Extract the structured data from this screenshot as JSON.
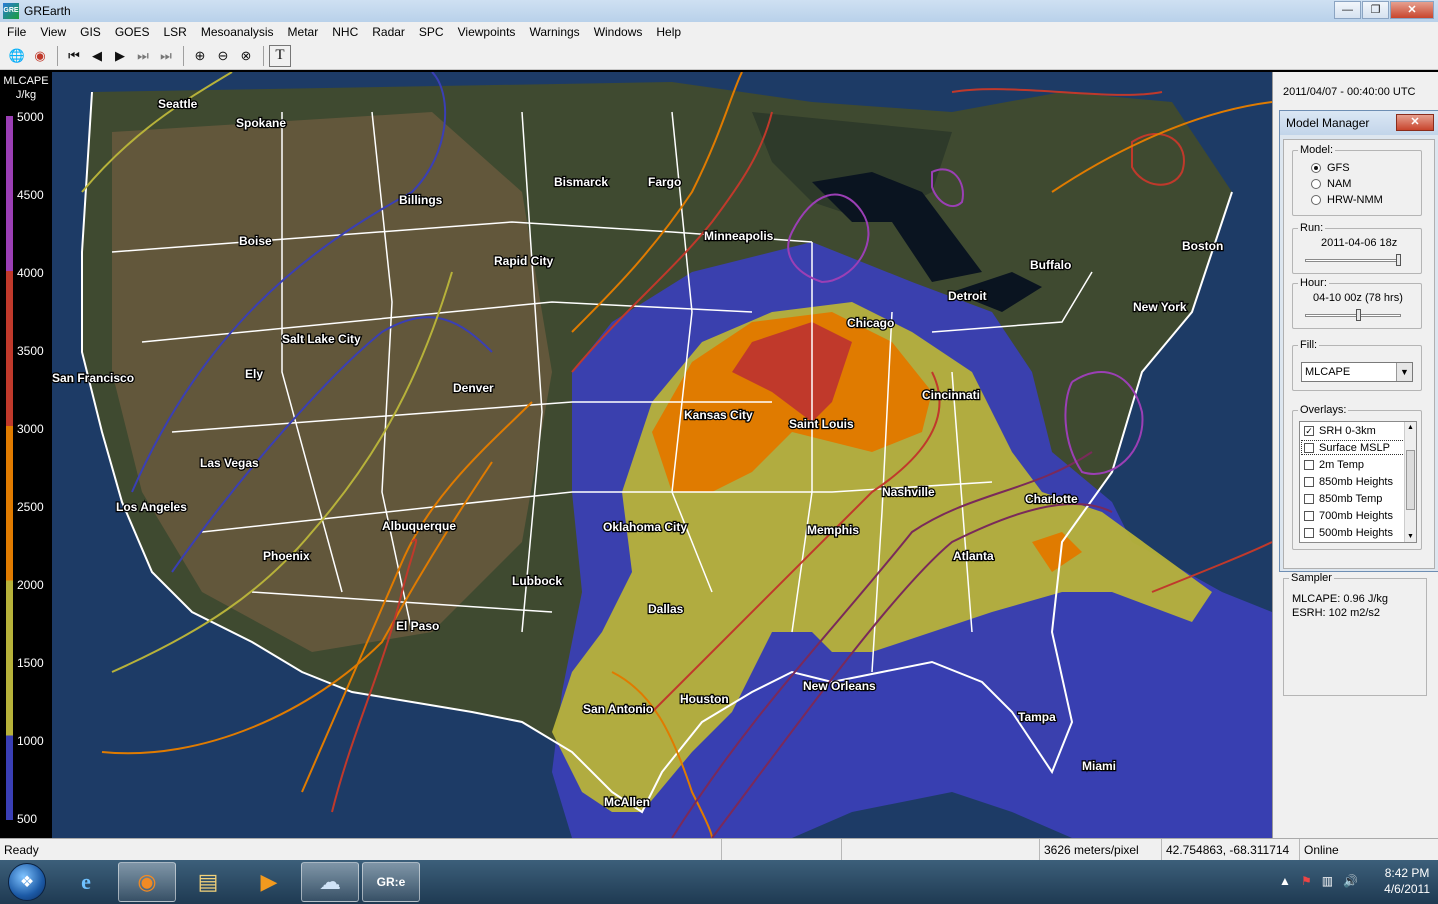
{
  "window": {
    "title": "GREarth",
    "app_icon": "GRE",
    "buttons": {
      "minimize": "—",
      "maximize": "❐",
      "close": "✕"
    }
  },
  "menu": [
    "File",
    "View",
    "GIS",
    "GOES",
    "LSR",
    "Mesoanalysis",
    "Metar",
    "NHC",
    "Radar",
    "SPC",
    "Viewpoints",
    "Warnings",
    "Windows",
    "Help"
  ],
  "toolbar": {
    "icons": [
      "globe-icon",
      "earth-red-icon",
      "first-frame-icon",
      "step-back-icon",
      "play-icon",
      "step-forward-icon",
      "last-frame-icon",
      "zoom-in-icon",
      "zoom-out-icon",
      "zoom-reset-icon",
      "text-tool-icon"
    ]
  },
  "legend": {
    "title": "MLCAPE",
    "unit": "J/kg",
    "ticks": [
      "5000",
      "4500",
      "4000",
      "3500",
      "3000",
      "2500",
      "2000",
      "1500",
      "1000",
      "500"
    ],
    "colors": {
      "purple": "#9b3fb5",
      "red": "#c0392b",
      "orange": "#e07b00",
      "yellow": "#b7b23a",
      "blue": "#3a3fb5"
    }
  },
  "map": {
    "cities": [
      "Seattle",
      "Spokane",
      "Billings",
      "Bismarck",
      "Fargo",
      "Boise",
      "Minneapolis",
      "Rapid City",
      "Buffalo",
      "Boston",
      "Detroit",
      "New York",
      "Chicago",
      "Salt Lake City",
      "San Francisco",
      "Ely",
      "Denver",
      "Kansas City",
      "Saint Louis",
      "Cincinnati",
      "Las Vegas",
      "Nashville",
      "Charlotte",
      "Los Angeles",
      "Albuquerque",
      "Oklahoma City",
      "Memphis",
      "Atlanta",
      "Phoenix",
      "Lubbock",
      "Dallas",
      "El Paso",
      "New Orleans",
      "San Antonio",
      "Houston",
      "Tampa",
      "Miami",
      "McAllen"
    ]
  },
  "panel": {
    "timestamp": "2011/04/07 - 00:40:00 UTC",
    "model_manager": {
      "title": "Model Manager",
      "close": "✕",
      "model_label": "Model:",
      "models": [
        "GFS",
        "NAM",
        "HRW-NMM"
      ],
      "selected_model": "GFS",
      "run_label": "Run:",
      "run_value": "2011-04-06 18z",
      "run_slider": 1.0,
      "hour_label": "Hour:",
      "hour_value": "04-10 00z (78 hrs)",
      "hour_slider": 0.55,
      "fill_label": "Fill:",
      "fill_value": "MLCAPE",
      "overlays_label": "Overlays:",
      "overlays": [
        {
          "name": "SRH 0-3km",
          "checked": true
        },
        {
          "name": "Surface MSLP",
          "checked": false
        },
        {
          "name": "2m Temp",
          "checked": false
        },
        {
          "name": "850mb Heights",
          "checked": false
        },
        {
          "name": "850mb Temp",
          "checked": false
        },
        {
          "name": "700mb Heights",
          "checked": false
        },
        {
          "name": "500mb Heights",
          "checked": false
        }
      ]
    },
    "sampler": {
      "label": "Sampler",
      "mlcape": "MLCAPE:  0.96 J/kg",
      "esrh": "ESRH:     102 m2/s2"
    }
  },
  "status": {
    "ready": "Ready",
    "scale": "3626 meters/pixel",
    "coords": "42.754863, -68.311714",
    "online": "Online"
  },
  "taskbar": {
    "clock_time": "8:42 PM",
    "clock_date": "4/6/2011",
    "gre_label": "GR:e"
  }
}
